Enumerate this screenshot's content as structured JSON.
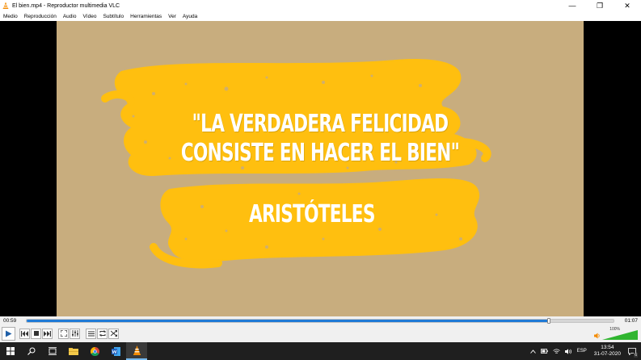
{
  "window": {
    "title": "El bien.mp4 - Reproductor multimedia VLC",
    "minimize_glyph": "—",
    "maximize_glyph": "❐",
    "close_glyph": "✕"
  },
  "menu": [
    "Medio",
    "Reproducción",
    "Audio",
    "Vídeo",
    "Subtítulo",
    "Herramientas",
    "Ver",
    "Ayuda"
  ],
  "video": {
    "quote_line1": "\"LA VERDADERA FELICIDAD",
    "quote_line2": "CONSISTE EN HACER EL BIEN\"",
    "author": "ARISTÓTELES",
    "background_color": "#c8ad7e",
    "brush_color": "#ffbf0f"
  },
  "playback": {
    "elapsed": "00:59",
    "total": "01:07",
    "progress": 0.89,
    "volume_label": "100%",
    "volume_level": 1.0,
    "accent_color": "#1f7ad6",
    "volume_color": "#2fb52f"
  },
  "controls": [
    "play-icon",
    "previous-icon",
    "stop-icon",
    "next-icon",
    "fullscreen-icon",
    "extended-settings-icon",
    "playlist-icon",
    "loop-icon",
    "shuffle-icon"
  ],
  "taskbar": {
    "apps": [
      "windows-start-icon",
      "search-icon",
      "task-view-icon",
      "file-explorer-icon",
      "chrome-icon",
      "word-icon",
      "vlc-icon"
    ],
    "language": "ESP",
    "time": "13:54",
    "date": "31-07-2020",
    "notification_count": "6"
  }
}
